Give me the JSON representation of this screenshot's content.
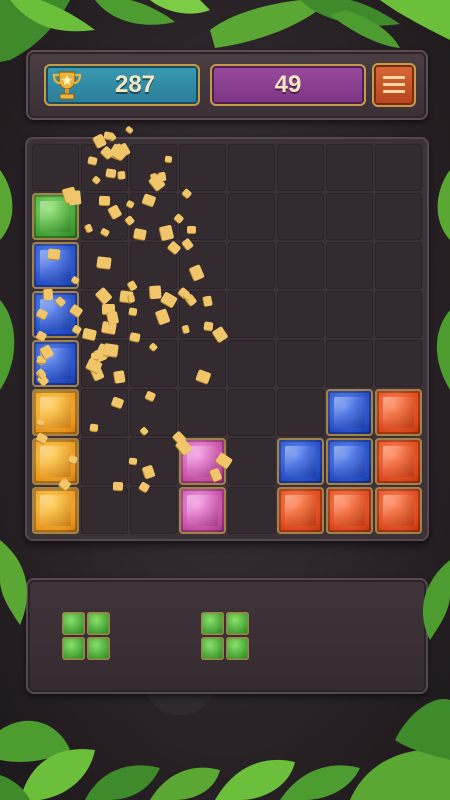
{
  "hud": {
    "best_score": "287",
    "current_score": "49",
    "trophy_icon": "trophy-icon",
    "menu_icon": "menu-icon"
  },
  "board": {
    "rows": 8,
    "cols": 8,
    "cells": [
      [
        "",
        "",
        "",
        "",
        "",
        "",
        "",
        ""
      ],
      [
        "green",
        "",
        "",
        "",
        "",
        "",
        "",
        ""
      ],
      [
        "blue",
        "",
        "",
        "",
        "",
        "",
        "",
        ""
      ],
      [
        "blue",
        "",
        "",
        "",
        "",
        "",
        "",
        ""
      ],
      [
        "blue",
        "",
        "",
        "",
        "",
        "",
        "",
        ""
      ],
      [
        "orange",
        "",
        "",
        "",
        "",
        "",
        "blue",
        "red"
      ],
      [
        "orange",
        "",
        "",
        "pink",
        "",
        "blue",
        "blue",
        "red"
      ],
      [
        "orange",
        "",
        "",
        "pink",
        "",
        "red",
        "red",
        "red"
      ]
    ]
  },
  "tray": {
    "pieces": [
      {
        "shape": "2x2 square",
        "color": "green"
      },
      {
        "shape": "2x2 square",
        "color": "green"
      }
    ]
  },
  "colors": {
    "green": "#3b9b2f",
    "blue": "#2149c2",
    "orange": "#e8931a",
    "pink": "#c2479f",
    "red": "#d8441a",
    "best_box": "#2a7d97",
    "score_box": "#7d3583",
    "menu_button": "#b5431d"
  }
}
